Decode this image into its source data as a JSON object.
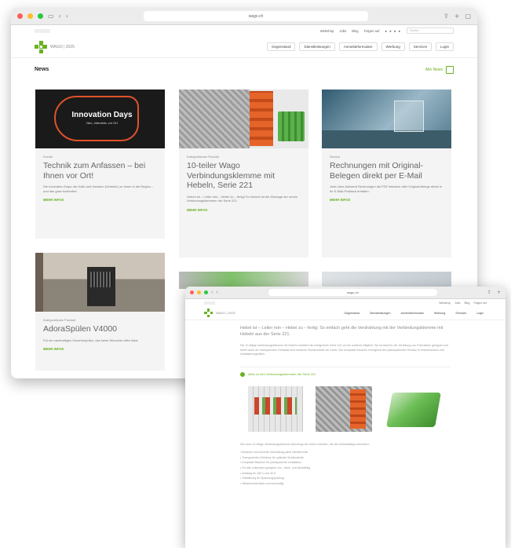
{
  "window1": {
    "url": "wago.ch",
    "util_links": [
      "Webshop",
      "Jobs",
      "Blog",
      "Folgen auf",
      "Suche"
    ],
    "search_placeholder": "Suche",
    "logo_text": "WAGO | 2025",
    "nav": [
      "Gegenstand",
      "Dienstleistungen",
      "Anmeldeformulare",
      "Werbung",
      "Services",
      "Login"
    ],
    "news_title": "News",
    "news_all_label": "Alle News",
    "cards": [
      {
        "category": "Events",
        "title": "Technik zum Anfassen – bei Ihnen vor Ort!",
        "desc": "Die Innovation Days: die Hallo und Hamann (Verteiler) zu Ihnen in die Region – und das ganz kostenfrei.",
        "more": "MEHR INFOS",
        "img_title": "Innovation Days",
        "img_sub": "Neu, interaktiv, vor Ort"
      },
      {
        "category": "Kategoriekram Produkt",
        "title": "10-teiler Wago Verbindungsklemme mit Hebeln, Serie 221",
        "desc": "Heben ist – Leiter rein – Hebel zu – fertig! So einfach ist die Montage der neuen Verbindungsklemmen der Serie 221.",
        "more": "MEHR INFOS"
      },
      {
        "category": "Service",
        "title": "Rechnungen mit Original-Belegen direkt per E-Mail",
        "desc": "Jetzt ohne Aufwand Rechnungen als PDF inklusive aller Original-Belege direkt in Ihr E-Mail-Postfach erhalten.",
        "more": "MEHR INFOS"
      },
      {
        "category": "Kategoriekram Produkt",
        "title": "AdoraSpülen V4000",
        "desc": "Für ein nachhaltiges Geschirrspülen, das keine Wünsche offen lässt.",
        "more": "MEHR INFOS"
      }
    ]
  },
  "window2": {
    "url": "wago.ch",
    "util_links": [
      "Webshop",
      "Jobs",
      "Blog",
      "Folgen auf"
    ],
    "logo_text": "WAGO | 2025",
    "nav": [
      "Gegenstand",
      "Dienstleistungen",
      "Anmeldeformulare",
      "Werbung",
      "Services",
      "Login"
    ],
    "lead": "Hebel ist – Leiter rein – Hebel zu – fertig: So einfach geht die Verdrahtung mit der Verbindungsklemme mit Hebeln aus der Serie 221.",
    "para": "Die 10-teilige Verbindungsklemme mit Hebeln erweitert die erfolgreiche Serie 221 um ein weiteres Mitglied. Sie ist ideal für die Verteilung von Potentialen geeignet und bietet dank der transparenten Gehäuse eine einfache Sichtkontrolle der Leiter. Die kompakte Bauform ermöglicht den platzsparenden Einsatz in Verteilerdosen und Installationsgeräten.",
    "download_label": "Alles zu den Verbindungsklemmen der Serie 221",
    "bullets_intro": "Die neue 10-teilige Verbindungsklemme überzeugt mit vielen Vorteilen, die den Arbeitsalltag erleichtern:",
    "bullets": [
      "Einfache und schnelle Verdrahtung dank Hebeltechnik",
      "Transparentes Gehäuse für optimale Sichtkontrolle",
      "Kompakte Bauform für platzsparende Installation",
      "Für alle Leiterarten geeignet: ein-, mehr- und feindrähtig",
      "Zulässig für 450 V und 32 A",
      "Testöffnung für Spannungsprüfung",
      "Wiederverwendbar und nachhaltig"
    ]
  }
}
